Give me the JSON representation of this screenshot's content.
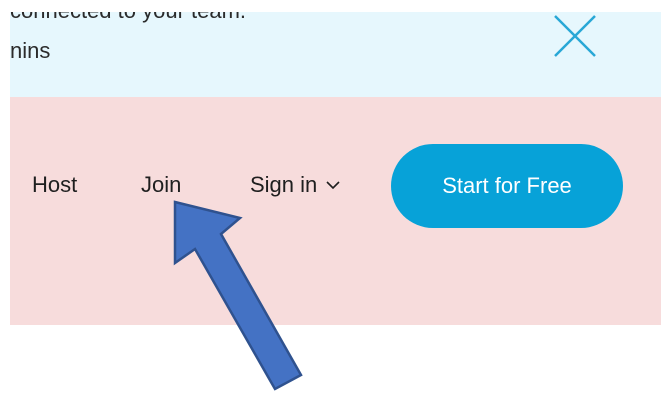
{
  "banner": {
    "line1": "connected to your team.",
    "line2": "nins",
    "close_icon": "close-icon"
  },
  "nav": {
    "host_label": "Host",
    "join_label": "Join",
    "signin_label": "Sign in",
    "signin_icon": "chevron-down-icon",
    "start_label": "Start for Free"
  },
  "colors": {
    "banner_bg": "#e6f7fd",
    "nav_bg": "#f7dcdc",
    "accent": "#07a2d8",
    "annotation_arrow": "#4472c4"
  }
}
